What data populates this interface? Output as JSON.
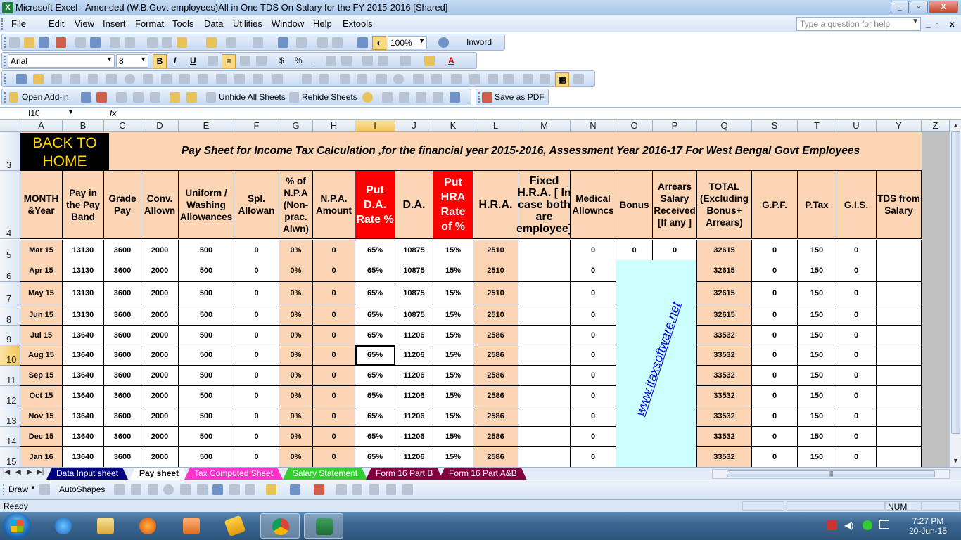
{
  "window": {
    "title": "Microsoft Excel - Amended (W.B.Govt employees)All in One TDS On Salary for the FY 2015-2016  [Shared]",
    "app_icon_label": "X",
    "minimize": "_",
    "restore": "▫",
    "close": "X"
  },
  "menu": {
    "items": [
      "File",
      "Edit",
      "View",
      "Insert",
      "Format",
      "Tools",
      "Data",
      "Utilities",
      "Window",
      "Help",
      "Extools"
    ],
    "help_placeholder": "Type a question for help"
  },
  "toolbar": {
    "zoom": "100%",
    "inword": "Inword",
    "font_name": "Arial",
    "font_size": "8",
    "bold": "B",
    "italic": "I",
    "underline": "U",
    "currency": "$",
    "percent": "%",
    "comma": ",",
    "font_color_label": "A",
    "open_addin": "Open Add-in",
    "unhide_sheets": "Unhide All Sheets",
    "rehide_sheets": "Rehide Sheets",
    "save_pdf": "Save as PDF"
  },
  "formula": {
    "name_box": "I10",
    "fx": "fx",
    "value": ""
  },
  "columns": [
    "A",
    "B",
    "C",
    "D",
    "E",
    "F",
    "G",
    "H",
    "I",
    "J",
    "K",
    "L",
    "M",
    "N",
    "O",
    "P",
    "Q",
    "S",
    "T",
    "U",
    "Y",
    "Z"
  ],
  "rows": [
    "3",
    "4",
    "5",
    "6",
    "7",
    "8",
    "9",
    "10",
    "11",
    "12",
    "13",
    "14",
    "15"
  ],
  "sheet": {
    "back_to_home": "BACK TO HOME",
    "title": "Pay Sheet for Income Tax Calculation ,for the financial year 2015-2016,  Assessment Year 2016-17   For West Bengal  Govt Employees",
    "headers": [
      "MONTH &Year",
      "Pay in the Pay Band",
      "Grade Pay",
      "Conv. Allown",
      "Uniform / Washing Allowances",
      "Spl. Allowan",
      "% of N.P.A (Non-prac. Alwn)",
      "N.P.A. Amount",
      "Put D.A. Rate %",
      "D.A.",
      "Put HRA Rate of %",
      "H.R.A.",
      "Fixed H.R.A. [ In case both are employee]",
      "Medical Allowncs",
      "Bonus",
      "Arrears Salary Received [If any ]",
      "TOTAL (Excluding Bonus+ Arrears)",
      "G.P.F.",
      "P.Tax",
      "G.I.S.",
      "TDS from Salary"
    ],
    "data_rows": [
      [
        "Mar 15",
        "13130",
        "3600",
        "2000",
        "500",
        "0",
        "0%",
        "0",
        "65%",
        "10875",
        "15%",
        "2510",
        "",
        "0",
        "0",
        "0",
        "32615",
        "0",
        "150",
        "0",
        ""
      ],
      [
        "Apr 15",
        "13130",
        "3600",
        "2000",
        "500",
        "0",
        "0%",
        "0",
        "65%",
        "10875",
        "15%",
        "2510",
        "",
        "0",
        "",
        "",
        "32615",
        "0",
        "150",
        "0",
        ""
      ],
      [
        "May 15",
        "13130",
        "3600",
        "2000",
        "500",
        "0",
        "0%",
        "0",
        "65%",
        "10875",
        "15%",
        "2510",
        "",
        "0",
        "",
        "",
        "32615",
        "0",
        "150",
        "0",
        ""
      ],
      [
        "Jun 15",
        "13130",
        "3600",
        "2000",
        "500",
        "0",
        "0%",
        "0",
        "65%",
        "10875",
        "15%",
        "2510",
        "",
        "0",
        "",
        "",
        "32615",
        "0",
        "150",
        "0",
        ""
      ],
      [
        "Jul 15",
        "13640",
        "3600",
        "2000",
        "500",
        "0",
        "0%",
        "0",
        "65%",
        "11206",
        "15%",
        "2586",
        "",
        "0",
        "",
        "",
        "33532",
        "0",
        "150",
        "0",
        ""
      ],
      [
        "Aug 15",
        "13640",
        "3600",
        "2000",
        "500",
        "0",
        "0%",
        "0",
        "65%",
        "11206",
        "15%",
        "2586",
        "",
        "0",
        "",
        "",
        "33532",
        "0",
        "150",
        "0",
        ""
      ],
      [
        "Sep 15",
        "13640",
        "3600",
        "2000",
        "500",
        "0",
        "0%",
        "0",
        "65%",
        "11206",
        "15%",
        "2586",
        "",
        "0",
        "",
        "",
        "33532",
        "0",
        "150",
        "0",
        ""
      ],
      [
        "Oct 15",
        "13640",
        "3600",
        "2000",
        "500",
        "0",
        "0%",
        "0",
        "65%",
        "11206",
        "15%",
        "2586",
        "",
        "0",
        "",
        "",
        "33532",
        "0",
        "150",
        "0",
        ""
      ],
      [
        "Nov 15",
        "13640",
        "3600",
        "2000",
        "500",
        "0",
        "0%",
        "0",
        "65%",
        "11206",
        "15%",
        "2586",
        "",
        "0",
        "",
        "",
        "33532",
        "0",
        "150",
        "0",
        ""
      ],
      [
        "Dec 15",
        "13640",
        "3600",
        "2000",
        "500",
        "0",
        "0%",
        "0",
        "65%",
        "11206",
        "15%",
        "2586",
        "",
        "0",
        "",
        "",
        "33532",
        "0",
        "150",
        "0",
        ""
      ],
      [
        "Jan 16",
        "13640",
        "3600",
        "2000",
        "500",
        "0",
        "0%",
        "0",
        "65%",
        "11206",
        "15%",
        "2586",
        "",
        "0",
        "",
        "",
        "33532",
        "0",
        "150",
        "0",
        ""
      ]
    ],
    "watermark": "www.itaxsoftware.net"
  },
  "tabs": [
    {
      "label": "Data Input sheet",
      "bg": "#000080",
      "fg": "#ffffff"
    },
    {
      "label": "Pay sheet",
      "bg": "#ffffff",
      "fg": "#000000"
    },
    {
      "label": "Tax Computed Sheet",
      "bg": "#ff33cc",
      "fg": "#ffffff"
    },
    {
      "label": "Salary Statement",
      "bg": "#33cc33",
      "fg": "#ffffff"
    },
    {
      "label": "Form 16 Part B",
      "bg": "#800040",
      "fg": "#ffffff"
    },
    {
      "label": "Form 16 Part A&B",
      "bg": "#800040",
      "fg": "#ffffff"
    }
  ],
  "drawbar": {
    "draw": "Draw",
    "autoshapes": "AutoShapes"
  },
  "status": {
    "ready": "Ready",
    "num": "NUM"
  },
  "taskbar": {
    "time": "7:27 PM",
    "date": "20-Jun-15"
  },
  "colors": {
    "peach": "#fcd5b4",
    "red_header": "#ff0000",
    "back_home_bg": "#000000",
    "back_home_fg": "#ffd700",
    "watermark_bg": "#ccffff",
    "watermark_fg": "#0000cc"
  }
}
